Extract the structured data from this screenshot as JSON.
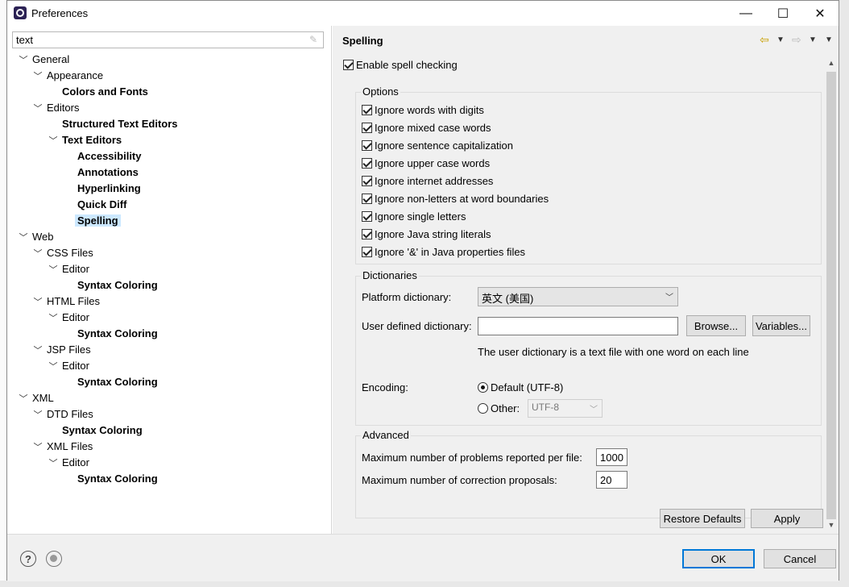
{
  "window": {
    "title": "Preferences",
    "min_glyph": "—",
    "max_glyph": "☐",
    "close_glyph": "✕"
  },
  "filter": {
    "value": "text"
  },
  "tree": [
    {
      "label": "General",
      "level": 0,
      "expanded": true,
      "bold": false
    },
    {
      "label": "Appearance",
      "level": 1,
      "expanded": true,
      "bold": false
    },
    {
      "label": "Colors and Fonts",
      "level": 2,
      "expanded": null,
      "bold": true
    },
    {
      "label": "Editors",
      "level": 1,
      "expanded": true,
      "bold": false
    },
    {
      "label": "Structured Text Editors",
      "level": 2,
      "expanded": null,
      "bold": true
    },
    {
      "label": "Text Editors",
      "level": 2,
      "expanded": true,
      "bold": true
    },
    {
      "label": "Accessibility",
      "level": 3,
      "expanded": null,
      "bold": true
    },
    {
      "label": "Annotations",
      "level": 3,
      "expanded": null,
      "bold": true
    },
    {
      "label": "Hyperlinking",
      "level": 3,
      "expanded": null,
      "bold": true
    },
    {
      "label": "Quick Diff",
      "level": 3,
      "expanded": null,
      "bold": true
    },
    {
      "label": "Spelling",
      "level": 3,
      "expanded": null,
      "bold": true,
      "selected": true
    },
    {
      "label": "Web",
      "level": 0,
      "expanded": true,
      "bold": false
    },
    {
      "label": "CSS Files",
      "level": 1,
      "expanded": true,
      "bold": false
    },
    {
      "label": "Editor",
      "level": 2,
      "expanded": true,
      "bold": false
    },
    {
      "label": "Syntax Coloring",
      "level": 3,
      "expanded": null,
      "bold": true
    },
    {
      "label": "HTML Files",
      "level": 1,
      "expanded": true,
      "bold": false
    },
    {
      "label": "Editor",
      "level": 2,
      "expanded": true,
      "bold": false
    },
    {
      "label": "Syntax Coloring",
      "level": 3,
      "expanded": null,
      "bold": true
    },
    {
      "label": "JSP Files",
      "level": 1,
      "expanded": true,
      "bold": false
    },
    {
      "label": "Editor",
      "level": 2,
      "expanded": true,
      "bold": false
    },
    {
      "label": "Syntax Coloring",
      "level": 3,
      "expanded": null,
      "bold": true
    },
    {
      "label": "XML",
      "level": 0,
      "expanded": true,
      "bold": false
    },
    {
      "label": "DTD Files",
      "level": 1,
      "expanded": true,
      "bold": false
    },
    {
      "label": "Syntax Coloring",
      "level": 2,
      "expanded": null,
      "bold": true
    },
    {
      "label": "XML Files",
      "level": 1,
      "expanded": true,
      "bold": false
    },
    {
      "label": "Editor",
      "level": 2,
      "expanded": true,
      "bold": false
    },
    {
      "label": "Syntax Coloring",
      "level": 3,
      "expanded": null,
      "bold": true
    }
  ],
  "page": {
    "title": "Spelling",
    "enable_spell": {
      "label": "Enable spell checking",
      "checked": true
    },
    "options": {
      "title": "Options",
      "items": [
        {
          "label": "Ignore words with digits",
          "checked": true
        },
        {
          "label": "Ignore mixed case words",
          "checked": true
        },
        {
          "label": "Ignore sentence capitalization",
          "checked": true
        },
        {
          "label": "Ignore upper case words",
          "checked": true
        },
        {
          "label": "Ignore internet addresses",
          "checked": true
        },
        {
          "label": "Ignore non-letters at word boundaries",
          "checked": true
        },
        {
          "label": "Ignore single letters",
          "checked": true
        },
        {
          "label": "Ignore Java string literals",
          "checked": true
        },
        {
          "label": "Ignore '&' in Java properties files",
          "checked": true
        }
      ]
    },
    "dictionaries": {
      "title": "Dictionaries",
      "platform_label": "Platform dictionary:",
      "platform_value": "英文 (美国)",
      "user_label": "User defined dictionary:",
      "user_value": "",
      "browse_label": "Browse...",
      "variables_label": "Variables...",
      "hint": "The user dictionary is a text file with one word on each line",
      "encoding_label": "Encoding:",
      "default_label": "Default (UTF-8)",
      "other_label": "Other:",
      "other_value": "UTF-8"
    },
    "advanced": {
      "title": "Advanced",
      "max_problems_label": "Maximum number of problems reported per file:",
      "max_problems_value": "1000",
      "max_proposals_label": "Maximum number of correction proposals:",
      "max_proposals_value": "20"
    },
    "restore_label": "Restore Defaults",
    "apply_label": "Apply"
  },
  "footer": {
    "ok_label": "OK",
    "cancel_label": "Cancel",
    "help_glyph": "?"
  }
}
